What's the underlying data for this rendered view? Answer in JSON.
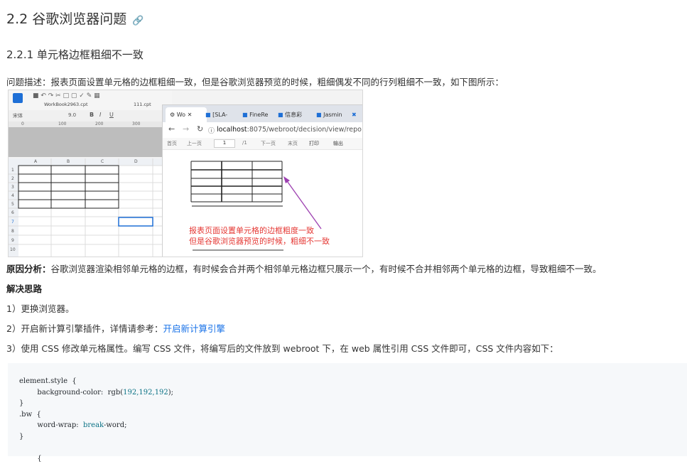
{
  "heading": {
    "title": "2.2 谷歌浏览器问题",
    "link_icon": "link-icon"
  },
  "subheading": "2.2.1 单元格边框粗细不一致",
  "problem": "问题描述：报表页面设置单元格的边框粗细一致，但是谷歌浏览器预览的时候，粗细偶发不同的行列粗细不一致，如下图所示：",
  "screenshot": {
    "designer_file_tab": "WorkBook2963.cpt",
    "designer_file_tab2": "111.cpt",
    "font_name": "宋体",
    "font_size": "9.0",
    "ruler": [
      "0",
      "100",
      "200",
      "300"
    ],
    "col_headers": [
      "A",
      "B",
      "C",
      "D"
    ],
    "row_headers": [
      "1",
      "2",
      "3",
      "4",
      "5",
      "6",
      "7",
      "8",
      "9",
      "10"
    ],
    "browser_tabs": [
      "Wo",
      "[SLA-",
      "FineRe",
      "信息彩",
      "Jasmin"
    ],
    "url_host": "localhost",
    "url_rest": ":8075/webroot/decision/view/repo",
    "pager": {
      "first": "首页",
      "prev": "上一页",
      "page": "1",
      "total": "/1",
      "next": "下一页",
      "last": "末页",
      "print": "打印",
      "export": "输出"
    },
    "annotation_line1": "报表页面设置单元格的边框粗度一致",
    "annotation_line2": "但是谷歌浏览器预览的时候，粗细不一致"
  },
  "analysis": {
    "label": "原因分析：",
    "text": "谷歌浏览器渲染相邻单元格的边框，有时候会合并两个相邻单元格边框只展示一个，有时候不合并相邻两个单元格的边框，导致粗细不一致。"
  },
  "solution_title": "解决思路",
  "steps": {
    "s1": "1）更换浏览器。",
    "s2_text": "2）开启新计算引擎插件，详情请参考：",
    "s2_link": "开启新计算引擎",
    "s3": "3）使用 CSS 修改单元格属性。编写 CSS 文件，将编写后的文件放到 webroot 下，在 web 属性引用 CSS 文件即可，CSS 文件内容如下："
  },
  "code": {
    "l1": "element.style  {",
    "l2a": "        background-color:  rgb(",
    "l2n": "192,192,192",
    "l2b": ");",
    "l3": "}",
    "l4": ".bw  {",
    "l5a": "        word-wrap:  ",
    "l5k": "break",
    "l5b": "-word;",
    "l6": "}",
    "l7": "",
    "l8": "        {"
  }
}
